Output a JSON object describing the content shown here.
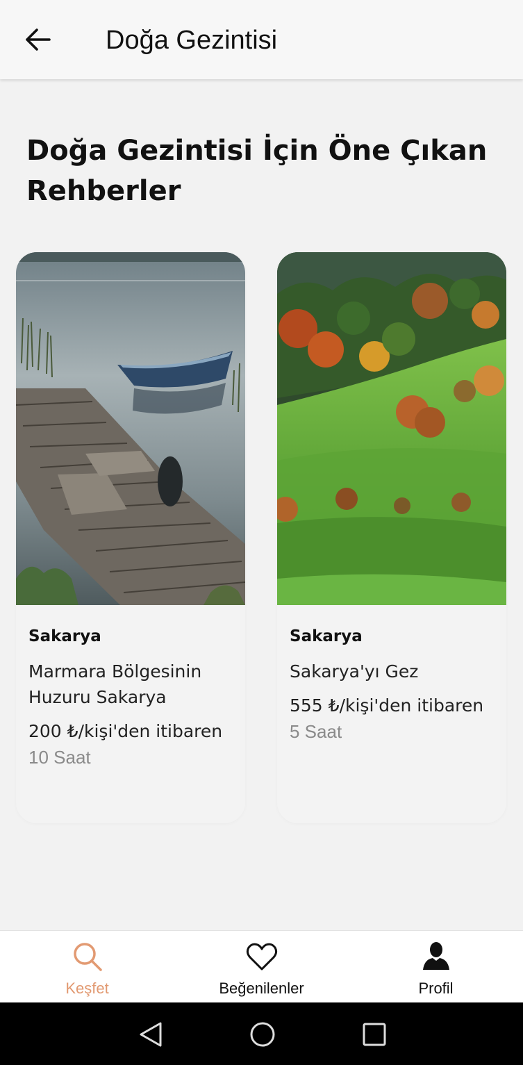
{
  "appbar": {
    "title": "Doğa Gezintisi",
    "back_icon": "arrow-left-icon"
  },
  "section": {
    "title": "Doğa Gezintisi İçin Öne Çıkan Rehberler"
  },
  "cards": [
    {
      "city": "Sakarya",
      "title": "Marmara Bölgesinin Huzuru Sakarya",
      "price": "200 ₺/kişi'den itibaren",
      "duration": "10 Saat"
    },
    {
      "city": "Sakarya",
      "title": "Sakarya'yı Gez",
      "price": "555 ₺/kişi'den itibaren",
      "duration": "5 Saat"
    }
  ],
  "bottom_nav": {
    "items": [
      {
        "label": "Keşfet",
        "icon": "search-icon",
        "active": true
      },
      {
        "label": "Beğenilenler",
        "icon": "heart-icon",
        "active": false
      },
      {
        "label": "Profil",
        "icon": "person-icon",
        "active": false
      }
    ]
  },
  "colors": {
    "accent": "#e29a72",
    "background": "#f2f2f2",
    "text": "#111111"
  },
  "system_nav": {
    "icons": [
      "back-triangle-icon",
      "home-circle-icon",
      "recents-square-icon"
    ]
  }
}
